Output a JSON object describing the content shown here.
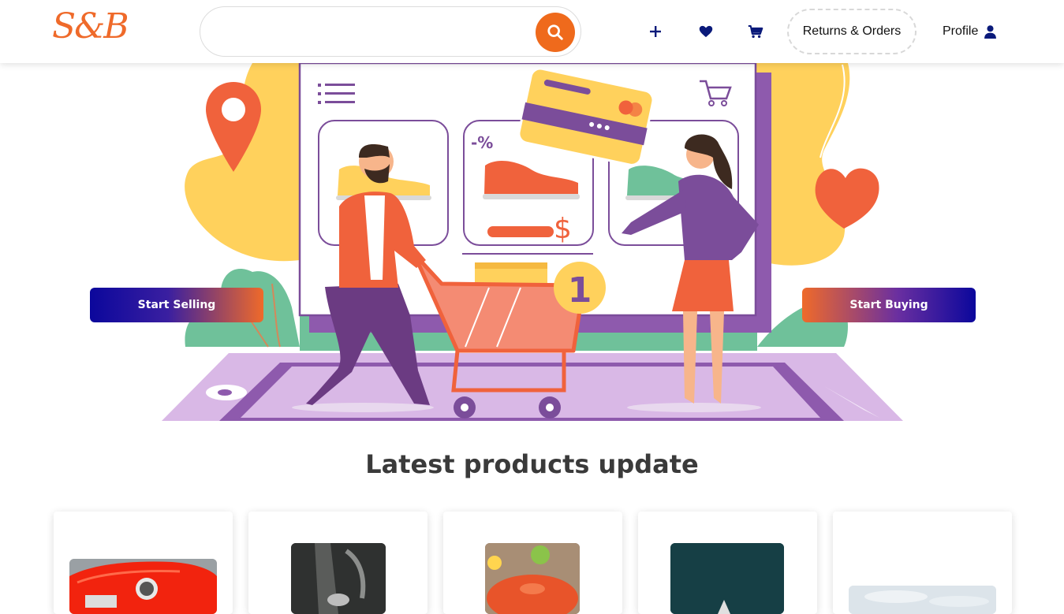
{
  "header": {
    "logo_text": "S&B",
    "search": {
      "placeholder": "",
      "value": ""
    },
    "icons": [
      "plus-icon",
      "heart-icon",
      "cart-icon",
      "search-icon",
      "user-icon"
    ],
    "returns_label": "Returns & Orders",
    "profile_label": "Profile"
  },
  "hero": {
    "start_selling_label": "Start Selling",
    "start_buying_label": "Start Buying",
    "illustration_text": {
      "discount": "-%",
      "currency": "$",
      "cart_count": "1"
    }
  },
  "products": {
    "section_title": "Latest products update",
    "items": [
      {
        "image": "red-car"
      },
      {
        "image": "espresso-machine"
      },
      {
        "image": "orange-cooking-pot"
      },
      {
        "image": "dark-teal-product"
      },
      {
        "image": "light-sky-product"
      }
    ]
  },
  "colors": {
    "brand_orange": "#ef6a1c",
    "brand_navy": "#0b079c",
    "icon_navy": "#0a1a7a",
    "text_dark": "#3a3a3a"
  }
}
